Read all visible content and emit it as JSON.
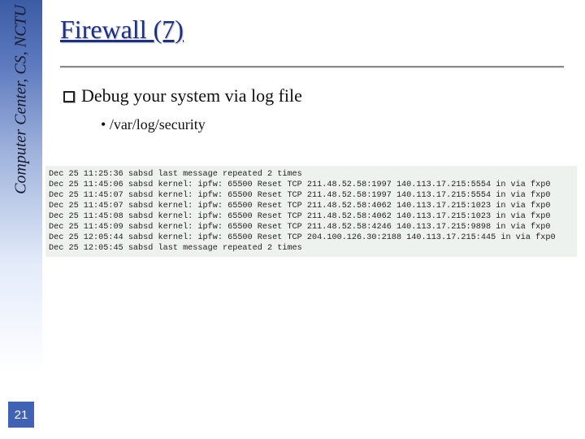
{
  "sidebar": {
    "label": "Computer Center, CS, NCTU"
  },
  "page_number": "21",
  "title": "Firewall (7)",
  "bullets": {
    "main": "Debug your system via log file",
    "sub": "/var/log/security"
  },
  "log_lines": [
    "Dec 25 11:25:36 sabsd last message repeated 2 times",
    "Dec 25 11:45:06 sabsd kernel: ipfw: 65500 Reset TCP 211.48.52.58:1997 140.113.17.215:5554 in via fxp0",
    "Dec 25 11:45:07 sabsd kernel: ipfw: 65500 Reset TCP 211.48.52.58:1997 140.113.17.215:5554 in via fxp0",
    "Dec 25 11:45:07 sabsd kernel: ipfw: 65500 Reset TCP 211.48.52.58:4062 140.113.17.215:1023 in via fxp0",
    "Dec 25 11:45:08 sabsd kernel: ipfw: 65500 Reset TCP 211.48.52.58:4062 140.113.17.215:1023 in via fxp0",
    "Dec 25 11:45:09 sabsd kernel: ipfw: 65500 Reset TCP 211.48.52.58:4246 140.113.17.215:9898 in via fxp0",
    "Dec 25 12:05:44 sabsd kernel: ipfw: 65500 Reset TCP 204.100.126.30:2188 140.113.17.215:445 in via fxp0",
    "Dec 25 12:05:45 sabsd last message repeated 2 times"
  ]
}
